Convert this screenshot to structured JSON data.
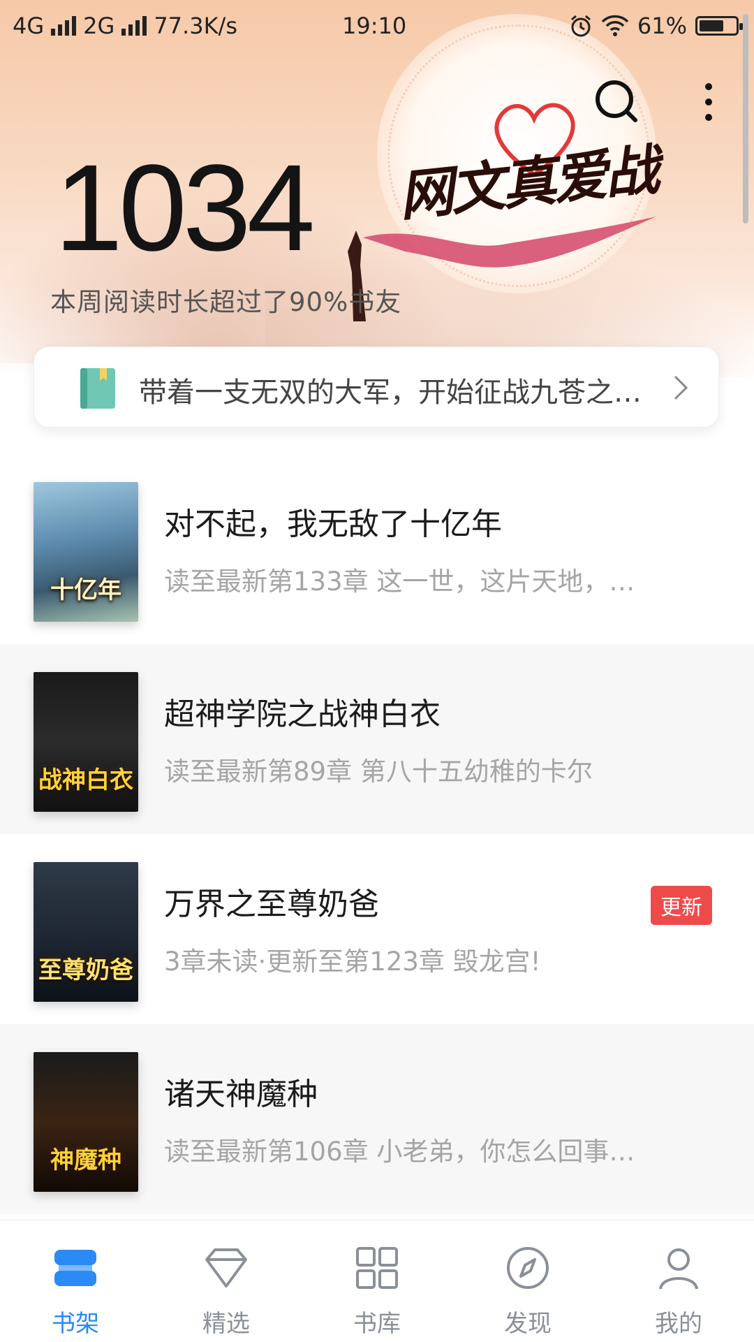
{
  "status_bar": {
    "network1": "4G",
    "network2": "2G",
    "speed": "77.3K/s",
    "time": "19:10",
    "battery": "61%"
  },
  "hero": {
    "reading_minutes": "1034",
    "summary": "本周阅读时长超过了90%书友",
    "banner_text": "网文真爱战"
  },
  "continue_reading": {
    "text": "带着一支无双的大军，开始征战九苍之…"
  },
  "books": [
    {
      "title": "对不起，我无敌了十亿年",
      "subtitle": "读至最新第133章 这一世，这片天地，…",
      "cover_text": "十亿年",
      "badge": ""
    },
    {
      "title": "超神学院之战神白衣",
      "subtitle": "读至最新第89章 第八十五幼稚的卡尔",
      "cover_text": "战神白衣",
      "badge": ""
    },
    {
      "title": "万界之至尊奶爸",
      "subtitle": "3章未读·更新至第123章 毁龙宫!",
      "cover_text": "至尊奶爸",
      "badge": "更新"
    },
    {
      "title": "诸天神魔种",
      "subtitle": "读至最新第106章 小老弟，你怎么回事…",
      "cover_text": "神魔种",
      "badge": ""
    }
  ],
  "nav": [
    {
      "label": "书架",
      "icon": "bookshelf-icon",
      "active": true
    },
    {
      "label": "精选",
      "icon": "diamond-icon",
      "active": false
    },
    {
      "label": "书库",
      "icon": "grid-icon",
      "active": false
    },
    {
      "label": "发现",
      "icon": "compass-icon",
      "active": false
    },
    {
      "label": "我的",
      "icon": "user-icon",
      "active": false
    }
  ],
  "colors": {
    "accent": "#2a8af6",
    "badge": "#ef4a4a"
  }
}
